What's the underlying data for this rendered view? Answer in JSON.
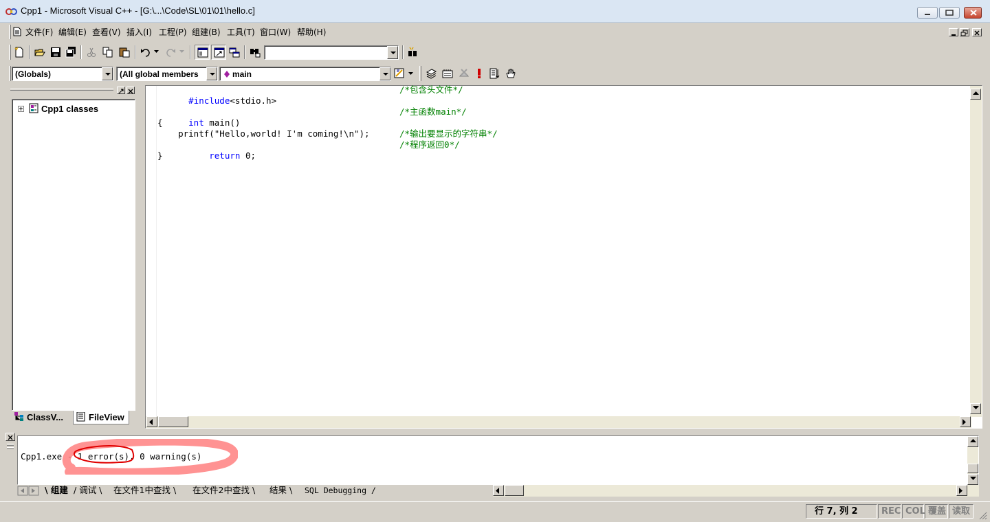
{
  "window": {
    "title": "Cpp1 - Microsoft Visual C++ - [G:\\...\\Code\\SL\\01\\01\\hello.c]"
  },
  "menu": [
    "文件(F)",
    "编辑(E)",
    "查看(V)",
    "插入(I)",
    "工程(P)",
    "组建(B)",
    "工具(T)",
    "窗口(W)",
    "帮助(H)"
  ],
  "toolbar": {
    "find_combo_value": ""
  },
  "wizardbar": {
    "class_combo": "(Globals)",
    "filter_combo": "(All global members",
    "member_combo": "main"
  },
  "workspace": {
    "tree_root": "Cpp1 classes",
    "tabs": [
      "ClassV...",
      "FileView"
    ]
  },
  "editor": {
    "lines": [
      {
        "code_kw": "#include",
        "code": "<stdio.h>",
        "comment": "/*包含头文件*/"
      },
      {
        "code_kw": "",
        "code": "",
        "comment": ""
      },
      {
        "code_kw": "int",
        "code": " main()",
        "comment": "/*主函数main*/"
      },
      {
        "code_kw": "",
        "code": "{",
        "comment": ""
      },
      {
        "code_kw": "",
        "code": "    printf(\"Hello,world! I'm coming!\\n\");",
        "comment": "/*输出要显示的字符串*/"
      },
      {
        "code_kw": "    return",
        "code": " 0;",
        "comment": "/*程序返回0*/"
      },
      {
        "code_kw": "",
        "code": "}",
        "comment": ""
      }
    ]
  },
  "output": {
    "text": "Cpp1.exe - 1 error(s), 0 warning(s)",
    "tabs": [
      "组建",
      "调试",
      "在文件1中查找",
      "在文件2中查找",
      "结果",
      "SQL Debugging"
    ]
  },
  "status": {
    "position": "行 7, 列 2",
    "rec": "REC",
    "col": "COL",
    "ovr": "覆盖",
    "read": "读取"
  },
  "annotation": {
    "color": "#ff6666"
  }
}
